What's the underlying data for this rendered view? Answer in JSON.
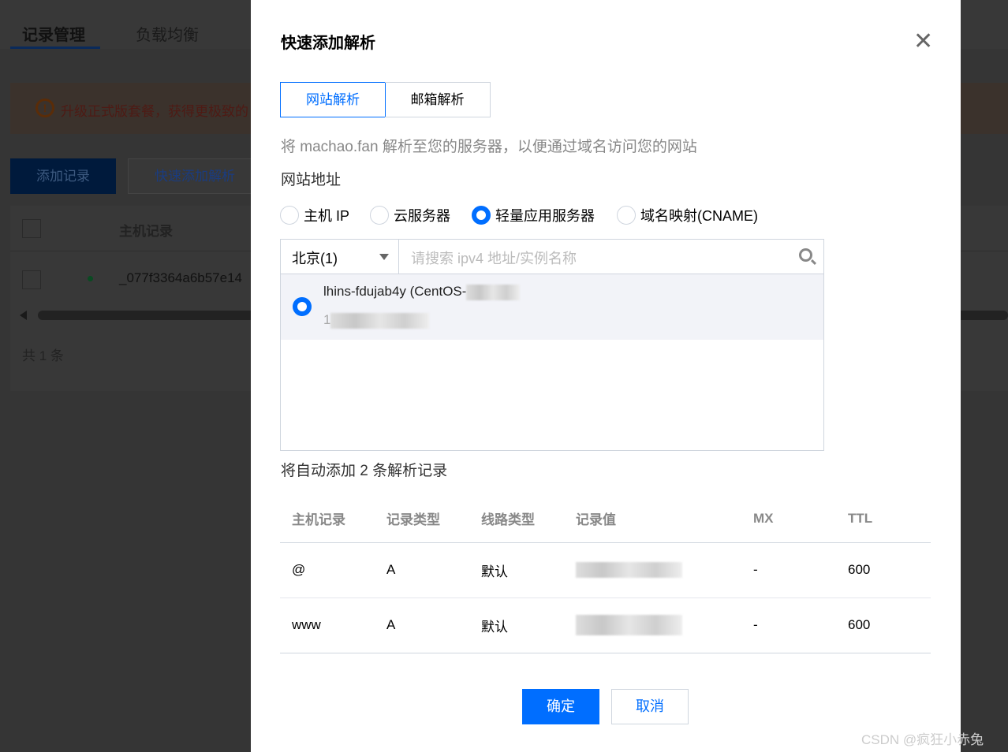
{
  "background": {
    "tabs": [
      "记录管理",
      "负载均衡"
    ],
    "notice": "升级正式版套餐，获得更极致的",
    "add_record": "添加记录",
    "quick_add": "快速添加解析",
    "table_header": "主机记录",
    "row_host": "_077f3364a6b57e14",
    "total": "共 1 条"
  },
  "dialog": {
    "title": "快速添加解析",
    "tabs": [
      "网站解析",
      "邮箱解析"
    ],
    "description": "将 machao.fan 解析至您的服务器，以便通过域名访问您的网站",
    "address_label": "网站地址",
    "radio_options": [
      {
        "label": "主机 IP",
        "selected": false
      },
      {
        "label": "云服务器",
        "selected": false
      },
      {
        "label": "轻量应用服务器",
        "selected": true
      },
      {
        "label": "域名映射(CNAME)",
        "selected": false
      }
    ],
    "region": "北京(1)",
    "search_placeholder": "请搜索 ipv4 地址/实例名称",
    "instance": {
      "name": "lhins-fdujab4y (CentOS-",
      "ip_prefix": "1",
      "selected": true
    },
    "auto_add_text": "将自动添加 2 条解析记录",
    "columns": [
      "主机记录",
      "记录类型",
      "线路类型",
      "记录值",
      "MX",
      "TTL"
    ],
    "rows": [
      {
        "host": "@",
        "type": "A",
        "line": "默认",
        "value": "",
        "mx": "-",
        "ttl": "600"
      },
      {
        "host": "www",
        "type": "A",
        "line": "默认",
        "value": "",
        "mx": "-",
        "ttl": "600"
      }
    ],
    "confirm": "确定",
    "cancel": "取消"
  },
  "watermark": "CSDN @疯狂小赤兔",
  "colors": {
    "accent": "#006eff"
  }
}
